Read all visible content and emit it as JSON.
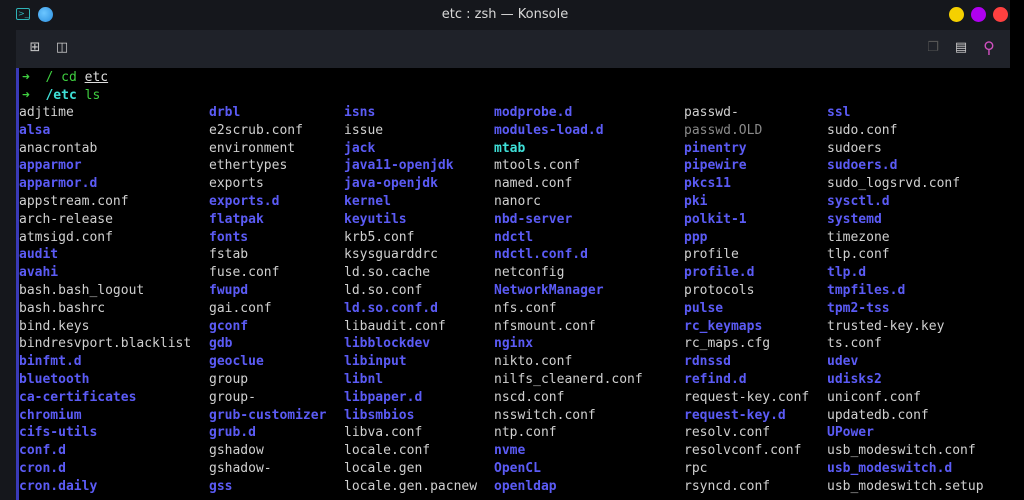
{
  "window": {
    "title": "etc : zsh — Konsole",
    "app_icon": ">_",
    "controls": {
      "minimize": "#f5d000",
      "maximize": "#b000f0",
      "close": "#ff4040"
    }
  },
  "toolbar": {
    "left": [
      {
        "icon": "new-tab-icon",
        "glyph": "⊞"
      },
      {
        "icon": "split-view-icon",
        "glyph": "◫"
      }
    ],
    "right": [
      {
        "icon": "copy-icon",
        "glyph": "❐"
      },
      {
        "icon": "paste-icon",
        "glyph": "▤"
      },
      {
        "icon": "search-icon",
        "glyph": "⚲"
      }
    ]
  },
  "prompt": [
    {
      "arrow": "➜",
      "dir": "/",
      "cmd": "cd",
      "arg": "etc"
    },
    {
      "arrow": "➜",
      "dir": "/etc",
      "cmd": "ls",
      "arg": ""
    }
  ],
  "columns": [
    [
      [
        "adjtime",
        ""
      ],
      [
        "alsa",
        "d"
      ],
      [
        "anacrontab",
        ""
      ],
      [
        "apparmor",
        "d"
      ],
      [
        "apparmor.d",
        "d"
      ],
      [
        "appstream.conf",
        ""
      ],
      [
        "arch-release",
        ""
      ],
      [
        "atmsigd.conf",
        ""
      ],
      [
        "audit",
        "d"
      ],
      [
        "avahi",
        "d"
      ],
      [
        "bash.bash_logout",
        ""
      ],
      [
        "bash.bashrc",
        ""
      ],
      [
        "bind.keys",
        ""
      ],
      [
        "bindresvport.blacklist",
        ""
      ],
      [
        "binfmt.d",
        "d"
      ],
      [
        "bluetooth",
        "d"
      ],
      [
        "ca-certificates",
        "d"
      ],
      [
        "chromium",
        "d"
      ],
      [
        "cifs-utils",
        "d"
      ],
      [
        "conf.d",
        "d"
      ],
      [
        "cron.d",
        "d"
      ],
      [
        "cron.daily",
        "d"
      ]
    ],
    [
      [
        "drbl",
        "d"
      ],
      [
        "e2scrub.conf",
        ""
      ],
      [
        "environment",
        ""
      ],
      [
        "ethertypes",
        ""
      ],
      [
        "exports",
        ""
      ],
      [
        "exports.d",
        "d"
      ],
      [
        "flatpak",
        "d"
      ],
      [
        "fonts",
        "d"
      ],
      [
        "fstab",
        ""
      ],
      [
        "fuse.conf",
        ""
      ],
      [
        "fwupd",
        "d"
      ],
      [
        "gai.conf",
        ""
      ],
      [
        "gconf",
        "d"
      ],
      [
        "gdb",
        "d"
      ],
      [
        "geoclue",
        "d"
      ],
      [
        "group",
        ""
      ],
      [
        "group-",
        ""
      ],
      [
        "grub-customizer",
        "d"
      ],
      [
        "grub.d",
        "d"
      ],
      [
        "gshadow",
        ""
      ],
      [
        "gshadow-",
        ""
      ],
      [
        "gss",
        "d"
      ]
    ],
    [
      [
        "isns",
        "d"
      ],
      [
        "issue",
        ""
      ],
      [
        "jack",
        "d"
      ],
      [
        "java11-openjdk",
        "d"
      ],
      [
        "java-openjdk",
        "d"
      ],
      [
        "kernel",
        "d"
      ],
      [
        "keyutils",
        "d"
      ],
      [
        "krb5.conf",
        ""
      ],
      [
        "ksysguarddrc",
        ""
      ],
      [
        "ld.so.cache",
        ""
      ],
      [
        "ld.so.conf",
        ""
      ],
      [
        "ld.so.conf.d",
        "d"
      ],
      [
        "libaudit.conf",
        ""
      ],
      [
        "libblockdev",
        "d"
      ],
      [
        "libinput",
        "d"
      ],
      [
        "libnl",
        "d"
      ],
      [
        "libpaper.d",
        "d"
      ],
      [
        "libsmbios",
        "d"
      ],
      [
        "libva.conf",
        ""
      ],
      [
        "locale.conf",
        ""
      ],
      [
        "locale.gen",
        ""
      ],
      [
        "locale.gen.pacnew",
        ""
      ]
    ],
    [
      [
        "modprobe.d",
        "d"
      ],
      [
        "modules-load.d",
        "d"
      ],
      [
        "mtab",
        "l"
      ],
      [
        "mtools.conf",
        ""
      ],
      [
        "named.conf",
        ""
      ],
      [
        "nanorc",
        ""
      ],
      [
        "nbd-server",
        "d"
      ],
      [
        "ndctl",
        "d"
      ],
      [
        "ndctl.conf.d",
        "d"
      ],
      [
        "netconfig",
        ""
      ],
      [
        "NetworkManager",
        "d"
      ],
      [
        "nfs.conf",
        ""
      ],
      [
        "nfsmount.conf",
        ""
      ],
      [
        "nginx",
        "d"
      ],
      [
        "nikto.conf",
        ""
      ],
      [
        "nilfs_cleanerd.conf",
        ""
      ],
      [
        "nscd.conf",
        ""
      ],
      [
        "nsswitch.conf",
        ""
      ],
      [
        "ntp.conf",
        ""
      ],
      [
        "nvme",
        "d"
      ],
      [
        "OpenCL",
        "d"
      ],
      [
        "openldap",
        "d"
      ]
    ],
    [
      [
        "passwd-",
        ""
      ],
      [
        "passwd.OLD",
        "x"
      ],
      [
        "pinentry",
        "d"
      ],
      [
        "pipewire",
        "d"
      ],
      [
        "pkcs11",
        "d"
      ],
      [
        "pki",
        "d"
      ],
      [
        "polkit-1",
        "d"
      ],
      [
        "ppp",
        "d"
      ],
      [
        "profile",
        ""
      ],
      [
        "profile.d",
        "d"
      ],
      [
        "protocols",
        ""
      ],
      [
        "pulse",
        "d"
      ],
      [
        "rc_keymaps",
        "d"
      ],
      [
        "rc_maps.cfg",
        ""
      ],
      [
        "rdnssd",
        "d"
      ],
      [
        "refind.d",
        "d"
      ],
      [
        "request-key.conf",
        ""
      ],
      [
        "request-key.d",
        "d"
      ],
      [
        "resolv.conf",
        ""
      ],
      [
        "resolvconf.conf",
        ""
      ],
      [
        "rpc",
        ""
      ],
      [
        "rsyncd.conf",
        ""
      ]
    ],
    [
      [
        "ssl",
        "d"
      ],
      [
        "sudo.conf",
        ""
      ],
      [
        "sudoers",
        ""
      ],
      [
        "sudoers.d",
        "d"
      ],
      [
        "sudo_logsrvd.conf",
        ""
      ],
      [
        "sysctl.d",
        "d"
      ],
      [
        "systemd",
        "d"
      ],
      [
        "timezone",
        ""
      ],
      [
        "tlp.conf",
        ""
      ],
      [
        "tlp.d",
        "d"
      ],
      [
        "tmpfiles.d",
        "d"
      ],
      [
        "tpm2-tss",
        "d"
      ],
      [
        "trusted-key.key",
        ""
      ],
      [
        "ts.conf",
        ""
      ],
      [
        "udev",
        "d"
      ],
      [
        "udisks2",
        "d"
      ],
      [
        "uniconf.conf",
        ""
      ],
      [
        "updatedb.conf",
        ""
      ],
      [
        "UPower",
        "d"
      ],
      [
        "usb_modeswitch.conf",
        ""
      ],
      [
        "usb_modeswitch.d",
        "d"
      ],
      [
        "usb_modeswitch.setup",
        ""
      ]
    ]
  ]
}
